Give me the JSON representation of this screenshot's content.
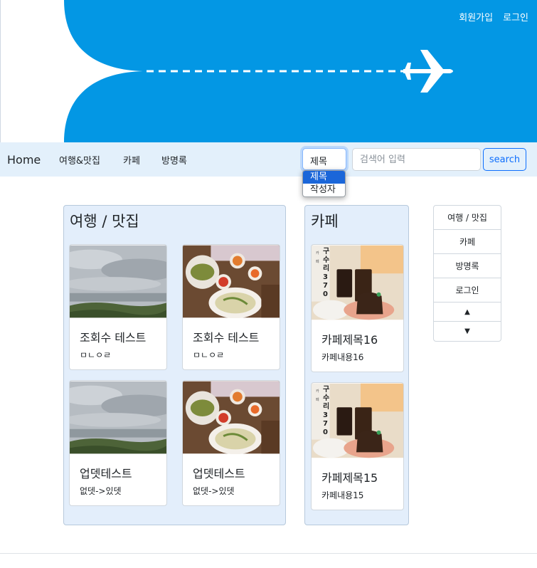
{
  "header": {
    "links": [
      {
        "label": "회원가입"
      },
      {
        "label": "로그인"
      }
    ],
    "colors": {
      "hero_blue": "#0397e4"
    }
  },
  "navbar": {
    "brand": "Home",
    "links": [
      "여행&맛집",
      "카페",
      "방명록"
    ],
    "search_type_value": "제목",
    "search_placeholder": "검색어 입력",
    "search_button": "search",
    "dropdown_options": [
      "제목",
      "작성자"
    ]
  },
  "travel": {
    "title": "여행 / 맛집",
    "cards": [
      {
        "title": "조회수 테스트",
        "text": "ㅁㄴㅇㄹ",
        "image": "landscape-photo"
      },
      {
        "title": "조회수 테스트",
        "text": "ㅁㄴㅇㄹ",
        "image": "food-photo"
      },
      {
        "title": "업뎃테스트",
        "text": "없뎃->있뎃",
        "image": "landscape-photo"
      },
      {
        "title": "업뎃테스트",
        "text": "없뎃->있뎃",
        "image": "food-photo"
      }
    ]
  },
  "cafe": {
    "title": "카페",
    "cards": [
      {
        "title": "카페제목16",
        "text": "카페내용16",
        "image": "cafe-photo",
        "sign": "구수리370",
        "sign_small": "카페"
      },
      {
        "title": "카페제목15",
        "text": "카페내용15",
        "image": "cafe-photo",
        "sign": "구수리370",
        "sign_small": "카페"
      }
    ]
  },
  "sidenav": {
    "items": [
      "여행 / 맛집",
      "카페",
      "방명록",
      "로그인"
    ],
    "up_icon": "▲",
    "down_icon": "▼"
  }
}
